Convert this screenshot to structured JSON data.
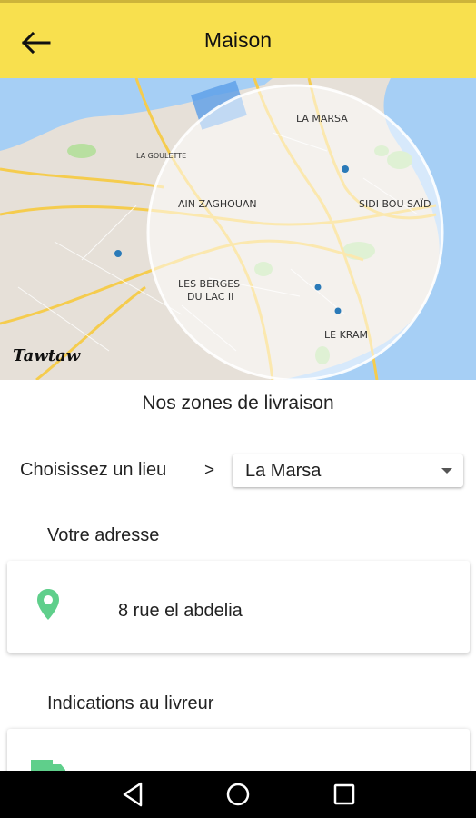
{
  "app_bar": {
    "title": "Maison",
    "back_icon": "arrow-left-icon",
    "background": "#f8e04e"
  },
  "map": {
    "brand": "Tawtaw",
    "places": [
      "LA MARSA",
      "SIDI BOU SAÏD",
      "AIN ZAGHOUAN",
      "LES BERGES",
      "DU LAC II",
      "LE KRAM",
      "LA GOULETTE"
    ],
    "colors": {
      "land": "#e6e0d8",
      "water": "#a6cff5",
      "road": "#f5cc4e",
      "park": "#b8dfa0",
      "zone": "rgba(255,255,255,0.5)"
    }
  },
  "zones_title": "Nos zones de livraison",
  "location": {
    "label": "Choisissez un lieu",
    "chevron": ">",
    "selected": "La Marsa"
  },
  "address": {
    "label": "Votre adresse",
    "value": "8 rue el abdelia",
    "icon": "map-pin-icon",
    "icon_color": "#5fcf8b"
  },
  "indications": {
    "label": "Indications au livreur",
    "icon": "truck-icon"
  },
  "nav": {
    "back": "triangle-back-icon",
    "home": "circle-home-icon",
    "recents": "square-recents-icon"
  }
}
